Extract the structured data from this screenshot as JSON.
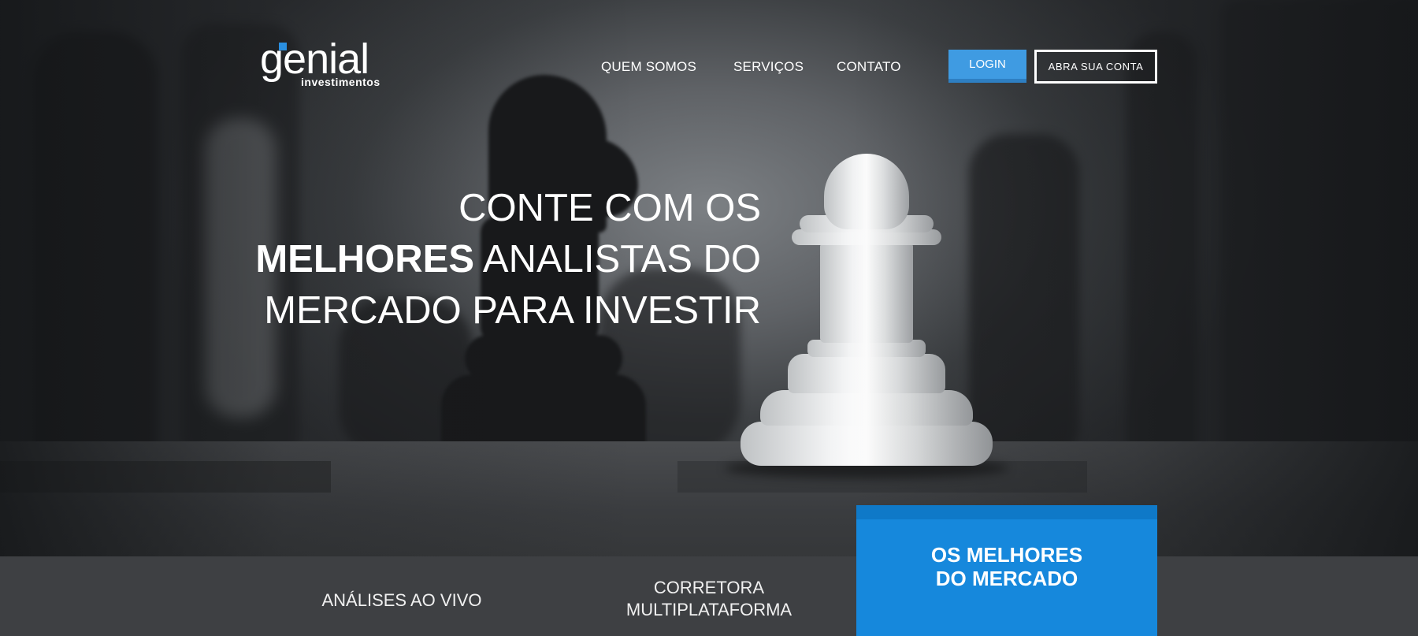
{
  "brand": {
    "name": "genial",
    "tagline": "investimentos",
    "accent_color": "#2a8fe0"
  },
  "nav": {
    "items": [
      "QUEM SOMOS",
      "SERVIÇOS",
      "CONTATO"
    ]
  },
  "header_actions": {
    "login_label": "LOGIN",
    "open_account_label": "ABRA SUA CONTA"
  },
  "hero": {
    "line1": "CONTE COM OS",
    "line2_bold": "MELHORES",
    "line2_rest": " ANALISTAS DO",
    "line3": "MERCADO PARA INVESTIR"
  },
  "features": {
    "item1": "ANÁLISES AO VIVO",
    "item2_line1": "CORRETORA",
    "item2_line2": "MULTIPLATAFORMA"
  },
  "callout": {
    "line1": "OS MELHORES",
    "line2": "DO MERCADO",
    "color": "#1688dc"
  }
}
